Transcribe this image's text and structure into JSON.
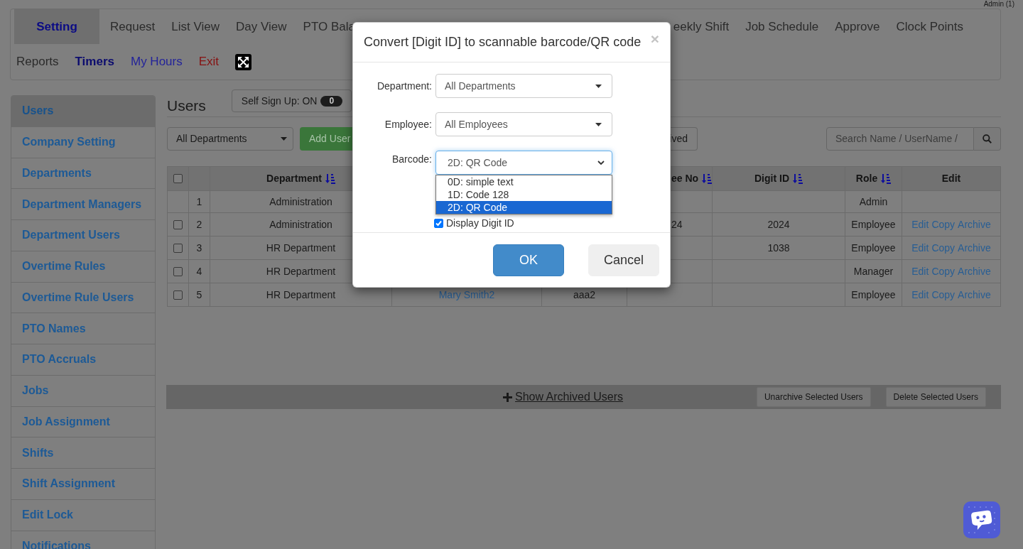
{
  "top_bar": {
    "account": "Admin (1)"
  },
  "nav": {
    "rows": [
      {
        "start": [
          {
            "label": "Setting",
            "kind": "tab",
            "selected": true
          },
          {
            "label": "Request",
            "kind": "tab",
            "selected": false
          },
          {
            "label": "List View",
            "kind": "tab",
            "selected": false
          },
          {
            "label": "Day View",
            "kind": "tab",
            "selected": false
          },
          {
            "label": "PTO Bala",
            "kind": "tab",
            "selected": false
          }
        ],
        "end": [
          {
            "label": "eekly Shift",
            "kind": "tab",
            "selected": false
          },
          {
            "label": "Job Schedule",
            "kind": "tab",
            "selected": false
          },
          {
            "label": "Approve",
            "kind": "tab",
            "selected": false
          },
          {
            "label": "Clock Points",
            "kind": "tab",
            "selected": false
          }
        ]
      },
      {
        "start": [
          {
            "label": "Reports",
            "kind": "tab",
            "selected": false
          },
          {
            "label": "Timers",
            "kind": "strong",
            "selected": false
          },
          {
            "label": "My Hours",
            "kind": "link",
            "selected": false
          },
          {
            "label": "Exit",
            "kind": "danger",
            "selected": false
          },
          {
            "kind": "fullscreen",
            "selected": false
          }
        ]
      }
    ]
  },
  "sidebar": {
    "items": [
      {
        "label": "Users",
        "selected": true
      },
      {
        "label": "Company Setting",
        "selected": false
      },
      {
        "label": "Departments",
        "selected": false
      },
      {
        "label": "Department Managers",
        "selected": false
      },
      {
        "label": "Department Users",
        "selected": false
      },
      {
        "label": "Overtime Rules",
        "selected": false
      },
      {
        "label": "Overtime Rule Users",
        "selected": false
      },
      {
        "label": "PTO Names",
        "selected": false
      },
      {
        "label": "PTO Accruals",
        "selected": false
      },
      {
        "label": "Jobs",
        "selected": false
      },
      {
        "label": "Job Assignment",
        "selected": false
      },
      {
        "label": "Shifts",
        "selected": false
      },
      {
        "label": "Shift Assignment",
        "selected": false
      },
      {
        "label": "Edit Lock",
        "selected": false
      },
      {
        "label": "Notifications",
        "selected": false
      }
    ]
  },
  "users": {
    "title": "Users",
    "self_sign_up": {
      "label": "Self Sign Up: ON",
      "count": "0"
    },
    "department_filter": "All Departments",
    "add_button": "Add User",
    "archived_button": "ived",
    "search": {
      "placeholder": "Search Name / UserName /"
    }
  },
  "table": {
    "header": {
      "checkbox": {
        "checked": false
      },
      "department": {
        "label": "Department",
        "sortable": true
      },
      "employee_no": {
        "label": "ee No",
        "sortable": true
      },
      "digit_id": {
        "label": "Digit ID",
        "sortable": true
      },
      "role": {
        "label": "Role",
        "sortable": true
      },
      "actions": {
        "label": "Edit"
      }
    },
    "rows": [
      {
        "number": "1",
        "department": "Administration",
        "role": "Admin"
      },
      {
        "checkbox": {
          "checked": false
        },
        "number": "2",
        "department": "Administration",
        "employee_no": "24",
        "digit_id": "2024",
        "role": "Employee",
        "actions": [
          "Edit",
          "Copy",
          "Archive"
        ]
      },
      {
        "checkbox": {
          "checked": false
        },
        "number": "3",
        "department": "HR Department",
        "digit_id": "1038",
        "role": "Employee",
        "actions": [
          "Edit",
          "Copy",
          "Archive"
        ]
      },
      {
        "checkbox": {
          "checked": false
        },
        "number": "4",
        "department": "HR Department",
        "role": "Manager",
        "actions": [
          "Edit",
          "Copy",
          "Archive"
        ]
      },
      {
        "checkbox": {
          "checked": false
        },
        "number": "5",
        "department": "HR Department",
        "column_4": "Mary Smith2",
        "column_5": "aaa2",
        "role": "Employee",
        "actions": [
          "Edit",
          "Copy",
          "Archive"
        ]
      }
    ]
  },
  "archive_bar": {
    "toggle": "Show Archived Users",
    "buttons": [
      "Unarchive Selected Users",
      "Delete Selected Users"
    ]
  },
  "dialog": {
    "title": "Convert [Digit ID] to scannable barcode/QR code",
    "close": "×",
    "fields": [
      {
        "label": "Department:",
        "kind": "dropdown",
        "value": "All Departments",
        "focused": false
      },
      {
        "label": "Employee:",
        "kind": "dropdown",
        "value": "All Employees",
        "focused": false
      },
      {
        "label": "Barcode:",
        "kind": "select",
        "value": "2D: QR Code",
        "focused": true,
        "options": [
          {
            "label": "0D: simple text",
            "selected": false
          },
          {
            "label": "1D: Code 128",
            "selected": false
          },
          {
            "label": "2D: QR Code",
            "selected": true
          }
        ]
      }
    ],
    "checkboxes": [
      {
        "label": "Display Digit ID",
        "checked": true
      }
    ],
    "buttons": [
      {
        "label": "OK",
        "kind": "primary"
      },
      {
        "label": "Cancel",
        "kind": "default"
      }
    ]
  }
}
